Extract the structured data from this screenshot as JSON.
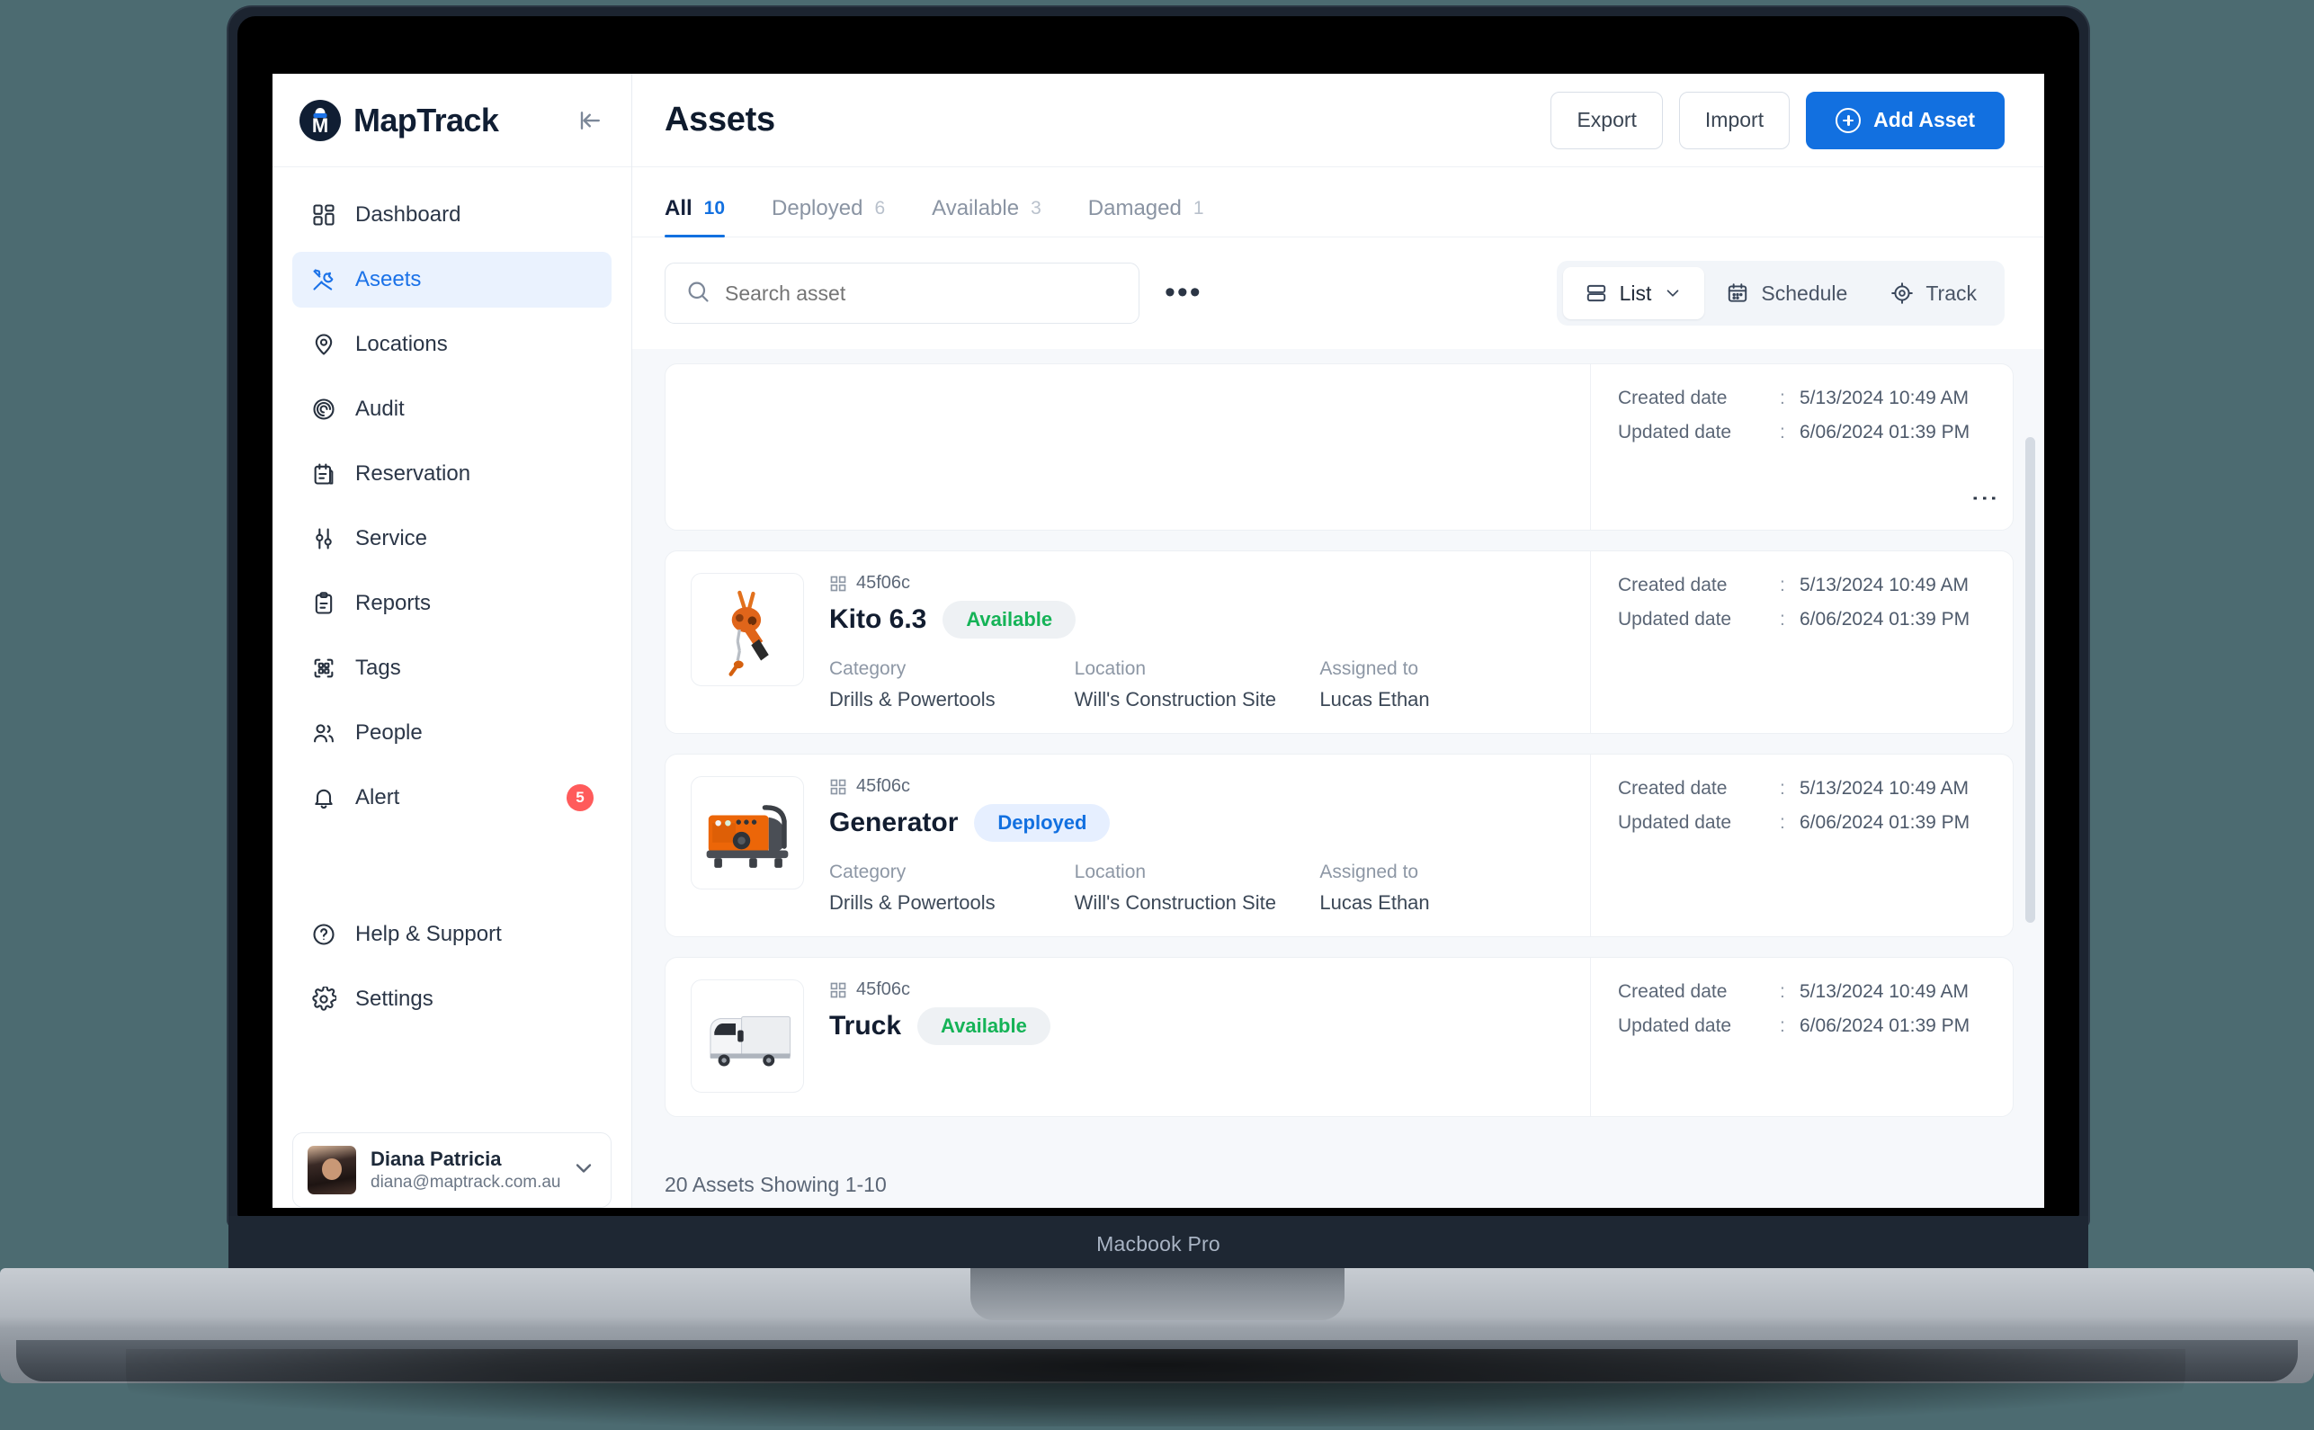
{
  "device": {
    "label": "Macbook Pro"
  },
  "brand": {
    "name": "MapTrack",
    "logo_icon": "maptrack-logo-icon",
    "collapse_icon": "collapse-sidebar-icon"
  },
  "sidebar": {
    "items": [
      {
        "label": "Dashboard",
        "icon": "dashboard-grid-icon",
        "active": false
      },
      {
        "label": "Aseets",
        "icon": "tools-icon",
        "active": true
      },
      {
        "label": "Locations",
        "icon": "map-pin-icon",
        "active": false
      },
      {
        "label": "Audit",
        "icon": "target-spiral-icon",
        "active": false
      },
      {
        "label": "Reservation",
        "icon": "clipboard-calendar-icon",
        "active": false
      },
      {
        "label": "Service",
        "icon": "sliders-icon",
        "active": false
      },
      {
        "label": "Reports",
        "icon": "clipboard-list-icon",
        "active": false
      },
      {
        "label": "Tags",
        "icon": "qr-code-icon",
        "active": false
      },
      {
        "label": "People",
        "icon": "users-icon",
        "active": false
      },
      {
        "label": "Alert",
        "icon": "bell-icon",
        "active": false,
        "badge": "5"
      }
    ],
    "bottom_items": [
      {
        "label": "Help & Support",
        "icon": "question-circle-icon"
      },
      {
        "label": "Settings",
        "icon": "gear-icon"
      }
    ],
    "profile": {
      "name": "Diana Patricia",
      "email": "diana@maptrack.com.au",
      "avatar_icon": "user-avatar",
      "chevron_icon": "chevron-down-icon"
    }
  },
  "header": {
    "title": "Assets",
    "export_label": "Export",
    "import_label": "Import",
    "add_asset_label": "Add Asset",
    "add_asset_icon": "plus-circle-icon"
  },
  "tabs": [
    {
      "label": "All",
      "count": "10",
      "active": true
    },
    {
      "label": "Deployed",
      "count": "6",
      "active": false
    },
    {
      "label": "Available",
      "count": "3",
      "active": false
    },
    {
      "label": "Damaged",
      "count": "1",
      "active": false
    }
  ],
  "toolbar": {
    "search_placeholder": "Search asset",
    "search_value": "",
    "search_icon": "search-icon",
    "more_icon": "ellipsis-icon",
    "views": [
      {
        "label": "List",
        "icon": "list-rows-icon",
        "active": true,
        "chevron": "chevron-down-icon"
      },
      {
        "label": "Schedule",
        "icon": "calendar-icon",
        "active": false
      },
      {
        "label": "Track",
        "icon": "crosshair-icon",
        "active": false
      }
    ]
  },
  "list": {
    "date_labels": {
      "created": "Created date",
      "updated": "Updated date",
      "separator": ":"
    },
    "meta_labels": {
      "category": "Category",
      "location": "Location",
      "assigned": "Assigned to"
    },
    "kebab_icon": "kebab-menu-icon",
    "qr_icon": "qr-code-icon",
    "footer": "20 Assets    Showing 1-10",
    "rows": [
      {
        "blank": true,
        "created": "5/13/2024 10:49 AM",
        "updated": "6/06/2024 01:39 PM"
      },
      {
        "blank": false,
        "qr_id": "45f06c",
        "name": "Kito 6.3",
        "status": "Available",
        "status_kind": "available",
        "thumb": "chain-hoist-image",
        "category": "Drills & Powertools",
        "location": "Will's Construction Site",
        "assigned": "Lucas Ethan",
        "created": "5/13/2024 10:49 AM",
        "updated": "6/06/2024 01:39 PM"
      },
      {
        "blank": false,
        "qr_id": "45f06c",
        "name": "Generator",
        "status": "Deployed",
        "status_kind": "deployed",
        "thumb": "generator-image",
        "category": "Drills & Powertools",
        "location": "Will's Construction Site",
        "assigned": "Lucas Ethan",
        "created": "5/13/2024 10:49 AM",
        "updated": "6/06/2024 01:39 PM"
      },
      {
        "blank": false,
        "qr_id": "45f06c",
        "name": "Truck",
        "status": "Available",
        "status_kind": "available",
        "thumb": "truck-image",
        "category": "",
        "location": "",
        "assigned": "",
        "created": "5/13/2024 10:49 AM",
        "updated": "6/06/2024 01:39 PM"
      }
    ]
  },
  "colors": {
    "accent": "#1270e0",
    "brand_dark": "#101e33",
    "available": "#15b357",
    "deployed": "#1270e0",
    "alert_badge": "#ff5b5b",
    "page_bg": "#4c6b71",
    "list_bg": "#f6f8fb"
  }
}
